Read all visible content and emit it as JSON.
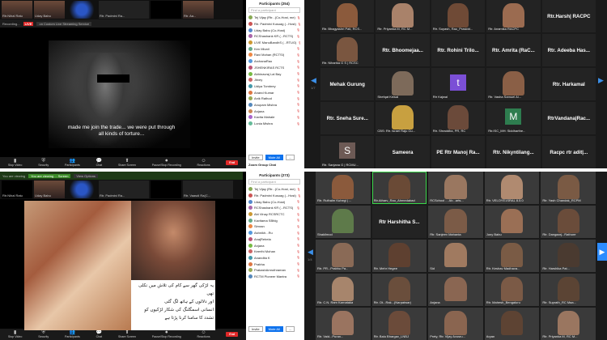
{
  "tl": {
    "strip": [
      {
        "label": "Rtr.Nihal Ratu",
        "kind": "face"
      },
      {
        "label": "Uday Babu",
        "kind": "face"
      },
      {
        "label": "",
        "kind": "logo"
      },
      {
        "label": "Rtr. Padmini Ra...",
        "kind": "wide"
      },
      {
        "label": "",
        "kind": "black"
      },
      {
        "label": "Rtr. Aa...",
        "kind": "face"
      }
    ],
    "topbar": {
      "recording": "Recording...",
      "live": "LIVE",
      "stream": "on Custom Live Streaming Service"
    },
    "subtitle": "made me join the trade... we were put through all kinds of torture..."
  },
  "bl": {
    "strip": [
      {
        "label": "Rtr.Nihal Ratu",
        "kind": "black"
      },
      {
        "label": "Uday Babu",
        "kind": "face"
      },
      {
        "label": "",
        "kind": "logo"
      },
      {
        "label": "Rtr. Padmini Ra...",
        "kind": "wide"
      },
      {
        "label": "",
        "kind": "black"
      },
      {
        "label": "Rtr. Vaasdi Ra(C...",
        "kind": "wide"
      }
    ],
    "sharebar": {
      "left": "You are viewing",
      "center": "You are viewing ... Screen",
      "options": "View Options"
    },
    "urdu": [
      "یہ لڑکی گھر سے کام کی تلاش میں نکلی تھی",
      "اور دلالوں کے ہاتھ لگ گئی",
      "انسانی اسمگلنگ کی شکار لڑکیوں کو",
      "تشدد کا سامنا کرنا پڑتا ہے"
    ]
  },
  "toolbar": {
    "buttons": [
      "Stop Video",
      "Security",
      "Participants",
      "Chat",
      "Share Screen",
      "Pause/Stop Recording",
      "Reactions"
    ],
    "end": "End"
  },
  "panel_top": {
    "title": "Participants (254)",
    "search": "Find a participant",
    "rows": [
      {
        "name": "Tej Vijay (Rtr...(Co-Host, me)",
        "color": "#8a5"
      },
      {
        "name": "Rtr. Padmini Kusuag (...Host)",
        "color": "#c55"
      },
      {
        "name": "Uday Babu (Co-Host)",
        "color": "#58c"
      },
      {
        "name": "RCShashank KR (...RCTS)",
        "color": "#a6a"
      },
      {
        "name": "LIVE ManuBandhS (...RTUG)",
        "color": "#c93"
      },
      {
        "name": "Ken Mlunil",
        "color": "#6a8"
      },
      {
        "name": "Ravi Mohan (RCTSI)",
        "color": "#e84"
      },
      {
        "name": "ArchanaRao",
        "color": "#59d"
      },
      {
        "name": "JSHENKIRAS RCTS",
        "color": "#b57"
      },
      {
        "name": "Abhinavraj Lal Bay",
        "color": "#7b4"
      },
      {
        "name": "Jitvey",
        "color": "#c66"
      },
      {
        "name": "Udiya Tombrey",
        "color": "#49a"
      },
      {
        "name": "Anand Kumar",
        "color": "#d74"
      },
      {
        "name": "Anik Rathod",
        "color": "#9a5"
      },
      {
        "name": "Anupam Mishra",
        "color": "#58b"
      },
      {
        "name": "Anjana",
        "color": "#c85"
      },
      {
        "name": "Kavita Mahale",
        "color": "#a6c"
      },
      {
        "name": "Lonia Mishra",
        "color": "#6b9"
      }
    ],
    "invite": "Invite",
    "mute_all": "Mute All",
    "more": "...",
    "footer": "Zoom Group Chat"
  },
  "panel_bottom": {
    "title": "Participants (273)",
    "search": "Find a participant",
    "rows": [
      {
        "name": "Tej Vijay (Rtr...(Co-Host, me)",
        "color": "#8a5"
      },
      {
        "name": "Rtr. Padmini Kusuag (...Host)",
        "color": "#c55"
      },
      {
        "name": "Uday Babu (Co-Host)",
        "color": "#58c"
      },
      {
        "name": "RCShashank KR (...RCTS)",
        "color": "#a6a"
      },
      {
        "name": "Abi Vinay RCSRCTC",
        "color": "#c93"
      },
      {
        "name": "Kavitama SBfdg",
        "color": "#6a8"
      },
      {
        "name": "Simran",
        "color": "#e84"
      },
      {
        "name": "Ashnikh...Ru",
        "color": "#59d"
      },
      {
        "name": "AnajRebela",
        "color": "#b57"
      },
      {
        "name": "Anjana",
        "color": "#7b4"
      },
      {
        "name": "Keerthi Mohan",
        "color": "#c66"
      },
      {
        "name": "Anandita K",
        "color": "#49a"
      },
      {
        "name": "Prabha",
        "color": "#d74"
      },
      {
        "name": "PrakashAmruthraman",
        "color": "#9a5"
      },
      {
        "name": "RCTM Pioneer Mantra",
        "color": "#58b"
      }
    ],
    "invite": "Invite",
    "mute_all": "Mute All",
    "more": "..."
  },
  "gallery_top": [
    {
      "name": "Rtr. Bhagyashri Pati, RCS...",
      "kind": "face",
      "c": "#8b5a3c"
    },
    {
      "name": "Rtr. Priyanka M, RC M...",
      "kind": "face",
      "c": "#a9826a"
    },
    {
      "name": "Rtr. Suyash, Rao_Prasidd...",
      "kind": "face",
      "c": "#6f4a36"
    },
    {
      "name": "Rtr. Anamika RACPC",
      "kind": "face",
      "c": "#9b6b50"
    },
    {
      "name": "Rtr.Harsh| RACPC",
      "kind": "big",
      "c": ""
    },
    {
      "name": "Rtr. Niharika G S | RCSC",
      "kind": "face",
      "c": "#7a5640"
    },
    {
      "name": "Rtr. Bhoomejaa...",
      "kind": "big",
      "c": ""
    },
    {
      "name": "Rtr. Rohini Trilo...",
      "kind": "big",
      "c": ""
    },
    {
      "name": "Rtr. Amrita (RaC...",
      "kind": "big",
      "c": ""
    },
    {
      "name": "Rtr. Adeeba Has...",
      "kind": "big",
      "c": ""
    },
    {
      "name": "Mehak Gurung",
      "kind": "big",
      "c": ""
    },
    {
      "name": "Shefqat Kewal",
      "kind": "face",
      "c": "#7d6a5a"
    },
    {
      "name": "Rtr Kajwal",
      "kind": "letter",
      "c": "#7b4fd6",
      "letter": "t"
    },
    {
      "name": "Rtr. Vasha Samuel Al...",
      "kind": "face",
      "c": "#8a5f46"
    },
    {
      "name": "Rtr. Harkamal",
      "kind": "big",
      "c": ""
    },
    {
      "name": "Rtr. Sneha Sure...",
      "kind": "big",
      "c": ""
    },
    {
      "name": "CBS: Rtr. Israel Raju Gu...",
      "kind": "face",
      "c": "#c8a040"
    },
    {
      "name": "Rtr. Shraddha, PR, RC",
      "kind": "face",
      "c": "#6b4a3a"
    },
    {
      "name": "Rtr.ISC_MH: Siddharthe...",
      "kind": "letter",
      "c": "#2e7d4f",
      "letter": "M"
    },
    {
      "name": "RtrVandana|Rac...",
      "kind": "big",
      "c": ""
    },
    {
      "name": "Rtr. Sanjana G | RCMU...",
      "kind": "letter",
      "c": "#6d5a55",
      "letter": "S"
    },
    {
      "name": "Sameera",
      "kind": "big",
      "c": ""
    },
    {
      "name": "PE Rtr Manoj Ra...",
      "kind": "big",
      "c": ""
    },
    {
      "name": "Rtr. Nikyntilang...",
      "kind": "big",
      "c": ""
    },
    {
      "name": "Racpc rtr adit|...",
      "kind": "big",
      "c": ""
    }
  ],
  "gallery_bottom": [
    {
      "name": "Rtr. Ruthalm Kuhegi | ...",
      "c": "#8b5a3c",
      "hl": false
    },
    {
      "name": "Rtr.Atharv_Rao_Ahmedabad",
      "c": "#6a4a36",
      "hl": true
    },
    {
      "name": "RCSchool ... Ab...arts...",
      "c": "#9a7760",
      "hl": false
    },
    {
      "name": "Rtr. VELOYE1SRAL 8.5.0",
      "c": "#b08a70",
      "hl": false
    },
    {
      "name": "Rtr. Yash Chandak_RCPM",
      "c": "#7a5a44",
      "hl": false
    },
    {
      "name": "Shakilmod",
      "c": "#5e7a4a",
      "hl": false
    },
    {
      "name": "Rtr Harshitha S...",
      "c": "",
      "hl": false
    },
    {
      "name": "Rtr. Sanjeev Mahanta",
      "c": "#7b5b47",
      "hl": false
    },
    {
      "name": "Juny Babu",
      "c": "#9a6f55",
      "hl": false
    },
    {
      "name": "Rtr. Dangaarj...Rathore",
      "c": "#6a4c3a",
      "hl": false
    },
    {
      "name": "Rtr. PR...Prabhu Pa...",
      "c": "#8a6a56",
      "hl": false
    },
    {
      "name": "Rtr. Mehr Hegee",
      "c": "#5e4030",
      "hl": false
    },
    {
      "name": "Sid",
      "c": "#a07a60",
      "hl": false
    },
    {
      "name": "Rtr. Keshav Madhava...",
      "c": "#7a5b45",
      "hl": false
    },
    {
      "name": "Rtr. Harshika Pat...",
      "c": "#4a3a30",
      "hl": false
    },
    {
      "name": "Rtr. C.N. Ram Karnataka",
      "c": "#a7856c",
      "hl": false
    },
    {
      "name": "Rtr. Ot...Rak...(Narpatwar)",
      "c": "#6a4e3c",
      "hl": false
    },
    {
      "name": "Anjana",
      "c": "#8a6652",
      "hl": false
    },
    {
      "name": "Rtr. Mahesh_Bengaluru",
      "c": "#7b5a46",
      "hl": false
    },
    {
      "name": "Rtr. Suprath_RC Maa...",
      "c": "#5b4434",
      "hl": false
    },
    {
      "name": "Rtr. Vaid...Puran...",
      "c": "#9a7460",
      "hl": false
    },
    {
      "name": "Rtr. Balu Bhargav_LNBJ",
      "c": "#6b4b3a",
      "hl": false
    },
    {
      "name": "Prety, Rtr. Vijay Avusru...",
      "c": "#8a6550",
      "hl": false
    },
    {
      "name": "Aryan",
      "c": "#5d4333",
      "hl": false
    },
    {
      "name": "Rtr. Priyanka M, RC M...",
      "c": "#9a7660",
      "hl": false
    }
  ],
  "pages": {
    "top": "1/7",
    "bottom": "1/4"
  },
  "self_names": [
    "Rtr. Padmini Ra...",
    "Rtr. Vaasdi Ra(C..."
  ]
}
